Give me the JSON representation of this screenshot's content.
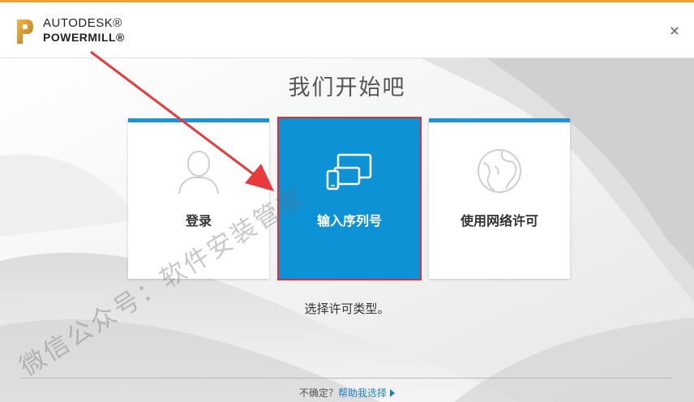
{
  "window": {
    "brand_line1": "AUTODESK®",
    "brand_line2": "POWERMILL®",
    "close_glyph": "×",
    "accent_color": "#f0a030"
  },
  "main": {
    "title": "我们开始吧",
    "cards": [
      {
        "label": "登录",
        "icon": "user-silhouette-icon"
      },
      {
        "label": "输入序列号",
        "icon": "devices-icon",
        "selected": true
      },
      {
        "label": "使用网络许可",
        "icon": "network-globe-icon"
      }
    ],
    "prompt": "选择许可类型。",
    "card_accent": "#1e93d4",
    "selected_color": "#0d92d5",
    "highlight_color": "#e03030"
  },
  "footer": {
    "question": "不确定？",
    "help_link": "帮助我选择"
  },
  "overlay": {
    "watermark": "微信公众号：软件安装管家",
    "arrow_color": "#e83a3a"
  }
}
